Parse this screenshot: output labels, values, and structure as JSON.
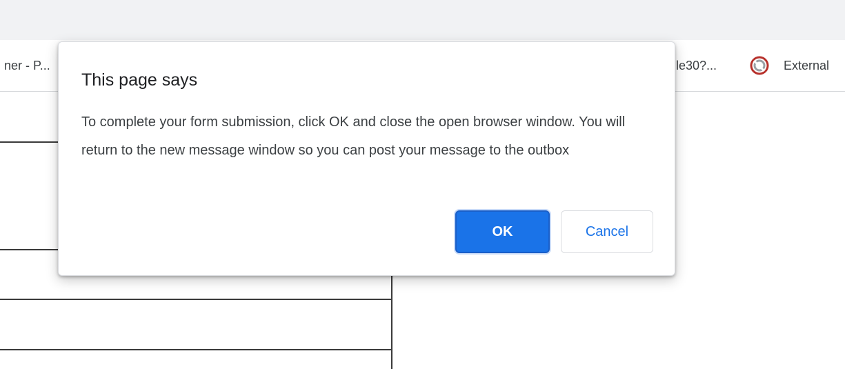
{
  "browser": {
    "bookmarks": {
      "left_item": "ner - P...",
      "middle_item": "le30?...",
      "right_item": "External",
      "right_item_icon": "external-site-icon"
    }
  },
  "dialog": {
    "title": "This page says",
    "message": "To complete your form submission, click OK and close the open browser window. You will return to the new message window so you can post your message to the outbox",
    "ok_label": "OK",
    "cancel_label": "Cancel"
  },
  "colors": {
    "accent": "#1a73e8",
    "topbar": "#f1f2f4"
  }
}
